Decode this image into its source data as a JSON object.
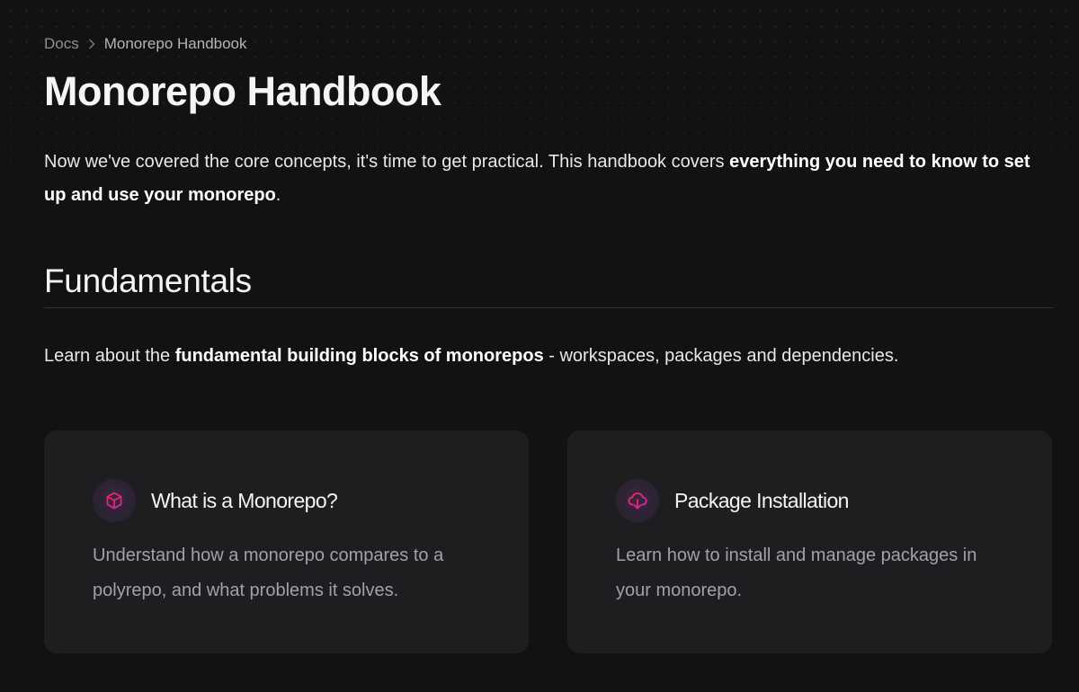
{
  "breadcrumb": {
    "root": "Docs",
    "current": "Monorepo Handbook"
  },
  "page": {
    "title": "Monorepo Handbook",
    "intro_before": "Now we've covered the core concepts, it's time to get practical. This handbook covers ",
    "intro_bold": "everything you need to know to set up and use your monorepo",
    "intro_after": "."
  },
  "section": {
    "title": "Fundamentals",
    "desc_before": "Learn about the ",
    "desc_bold": "fundamental building blocks of monorepos",
    "desc_after": " - workspaces, packages and dependencies."
  },
  "cards": [
    {
      "icon": "cube-icon",
      "title": "What is a Monorepo?",
      "description": "Understand how a monorepo compares to a polyrepo, and what problems it solves."
    },
    {
      "icon": "cloud-download-icon",
      "title": "Package Installation",
      "description": "Learn how to install and manage packages in your monorepo."
    }
  ],
  "colors": {
    "background": "#121213",
    "card_background": "#1e1e20",
    "icon_gradient_start": "#ff1e56",
    "icon_gradient_end": "#c62fa8",
    "muted_text": "#a1a1aa"
  }
}
